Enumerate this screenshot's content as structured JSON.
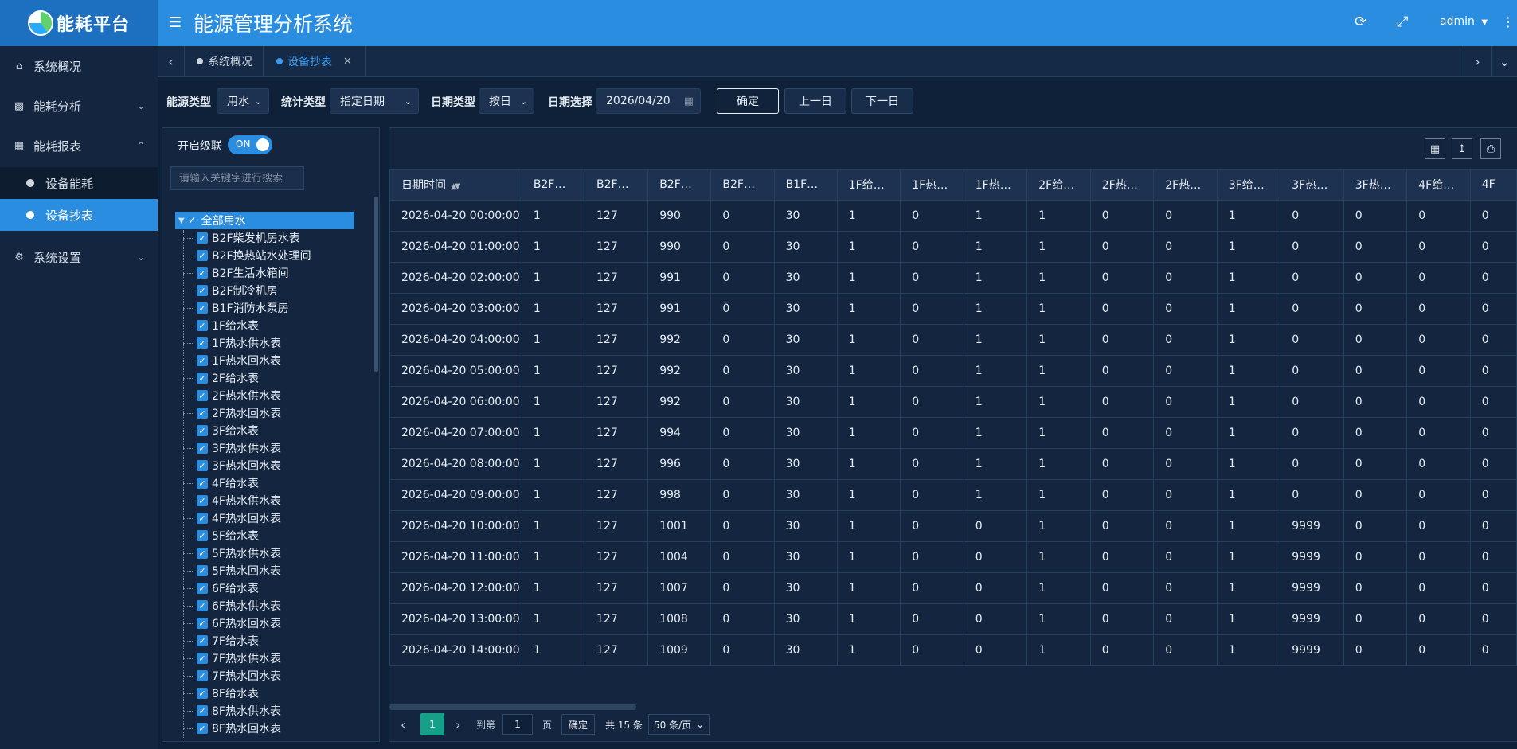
{
  "header": {
    "logo_text": "能耗平台",
    "app_title": "能源管理分析系统",
    "user": "admin"
  },
  "sidebar": {
    "items": [
      {
        "label": "系统概况",
        "icon": "home-icon"
      },
      {
        "label": "能耗分析",
        "icon": "bar-chart-icon"
      },
      {
        "label": "能耗报表",
        "icon": "table-icon"
      },
      {
        "label": "系统设置",
        "icon": "gear-icon"
      }
    ],
    "subitems": [
      {
        "label": "设备能耗"
      },
      {
        "label": "设备抄表"
      }
    ]
  },
  "tabs": [
    {
      "label": "系统概况"
    },
    {
      "label": "设备抄表"
    }
  ],
  "filters": {
    "energy_type_label": "能源类型",
    "energy_type_value": "用水",
    "stat_type_label": "统计类型",
    "stat_type_value": "指定日期",
    "date_type_label": "日期类型",
    "date_type_value": "按日",
    "date_select_label": "日期选择",
    "date_value": "2026/04/20",
    "confirm": "确定",
    "prev_day": "上一日",
    "next_day": "下一日"
  },
  "tree": {
    "cascade_label": "开启级联",
    "switch_text": "ON",
    "search_placeholder": "请输入关键字进行搜索",
    "root": "全部用水",
    "items": [
      "B2F柴发机房水表",
      "B2F换热站水处理间",
      "B2F生活水箱间",
      "B2F制冷机房",
      "B1F消防水泵房",
      "1F给水表",
      "1F热水供水表",
      "1F热水回水表",
      "2F给水表",
      "2F热水供水表",
      "2F热水回水表",
      "3F给水表",
      "3F热水供水表",
      "3F热水回水表",
      "4F给水表",
      "4F热水供水表",
      "4F热水回水表",
      "5F给水表",
      "5F热水供水表",
      "5F热水回水表",
      "6F给水表",
      "6F热水供水表",
      "6F热水回水表",
      "7F给水表",
      "7F热水供水表",
      "7F热水回水表",
      "8F给水表",
      "8F热水供水表",
      "8F热水回水表"
    ]
  },
  "table": {
    "columns": [
      "日期时间",
      "B2F…",
      "B2F…",
      "B2F…",
      "B2F…",
      "B1F…",
      "1F给…",
      "1F热…",
      "1F热…",
      "2F给…",
      "2F热…",
      "2F热…",
      "3F给…",
      "3F热…",
      "3F热…",
      "4F给…",
      "4F"
    ],
    "rows": [
      [
        "2026-04-20 00:00:00",
        "1",
        "127",
        "990",
        "0",
        "30",
        "1",
        "0",
        "1",
        "1",
        "0",
        "0",
        "1",
        "0",
        "0",
        "0",
        "0"
      ],
      [
        "2026-04-20 01:00:00",
        "1",
        "127",
        "990",
        "0",
        "30",
        "1",
        "0",
        "1",
        "1",
        "0",
        "0",
        "1",
        "0",
        "0",
        "0",
        "0"
      ],
      [
        "2026-04-20 02:00:00",
        "1",
        "127",
        "991",
        "0",
        "30",
        "1",
        "0",
        "1",
        "1",
        "0",
        "0",
        "1",
        "0",
        "0",
        "0",
        "0"
      ],
      [
        "2026-04-20 03:00:00",
        "1",
        "127",
        "991",
        "0",
        "30",
        "1",
        "0",
        "1",
        "1",
        "0",
        "0",
        "1",
        "0",
        "0",
        "0",
        "0"
      ],
      [
        "2026-04-20 04:00:00",
        "1",
        "127",
        "992",
        "0",
        "30",
        "1",
        "0",
        "1",
        "1",
        "0",
        "0",
        "1",
        "0",
        "0",
        "0",
        "0"
      ],
      [
        "2026-04-20 05:00:00",
        "1",
        "127",
        "992",
        "0",
        "30",
        "1",
        "0",
        "1",
        "1",
        "0",
        "0",
        "1",
        "0",
        "0",
        "0",
        "0"
      ],
      [
        "2026-04-20 06:00:00",
        "1",
        "127",
        "992",
        "0",
        "30",
        "1",
        "0",
        "1",
        "1",
        "0",
        "0",
        "1",
        "0",
        "0",
        "0",
        "0"
      ],
      [
        "2026-04-20 07:00:00",
        "1",
        "127",
        "994",
        "0",
        "30",
        "1",
        "0",
        "1",
        "1",
        "0",
        "0",
        "1",
        "0",
        "0",
        "0",
        "0"
      ],
      [
        "2026-04-20 08:00:00",
        "1",
        "127",
        "996",
        "0",
        "30",
        "1",
        "0",
        "1",
        "1",
        "0",
        "0",
        "1",
        "0",
        "0",
        "0",
        "0"
      ],
      [
        "2026-04-20 09:00:00",
        "1",
        "127",
        "998",
        "0",
        "30",
        "1",
        "0",
        "1",
        "1",
        "0",
        "0",
        "1",
        "0",
        "0",
        "0",
        "0"
      ],
      [
        "2026-04-20 10:00:00",
        "1",
        "127",
        "1001",
        "0",
        "30",
        "1",
        "0",
        "0",
        "1",
        "0",
        "0",
        "1",
        "9999",
        "0",
        "0",
        "0"
      ],
      [
        "2026-04-20 11:00:00",
        "1",
        "127",
        "1004",
        "0",
        "30",
        "1",
        "0",
        "0",
        "1",
        "0",
        "0",
        "1",
        "9999",
        "0",
        "0",
        "0"
      ],
      [
        "2026-04-20 12:00:00",
        "1",
        "127",
        "1007",
        "0",
        "30",
        "1",
        "0",
        "0",
        "1",
        "0",
        "0",
        "1",
        "9999",
        "0",
        "0",
        "0"
      ],
      [
        "2026-04-20 13:00:00",
        "1",
        "127",
        "1008",
        "0",
        "30",
        "1",
        "0",
        "0",
        "1",
        "0",
        "0",
        "1",
        "9999",
        "0",
        "0",
        "0"
      ],
      [
        "2026-04-20 14:00:00",
        "1",
        "127",
        "1009",
        "0",
        "30",
        "1",
        "0",
        "0",
        "1",
        "0",
        "0",
        "1",
        "9999",
        "0",
        "0",
        "0"
      ]
    ]
  },
  "pager": {
    "current": "1",
    "goto_label": "到第",
    "goto_value": "1",
    "page_unit": "页",
    "confirm": "确定",
    "total": "共 15 条",
    "page_size": "50 条/页"
  }
}
